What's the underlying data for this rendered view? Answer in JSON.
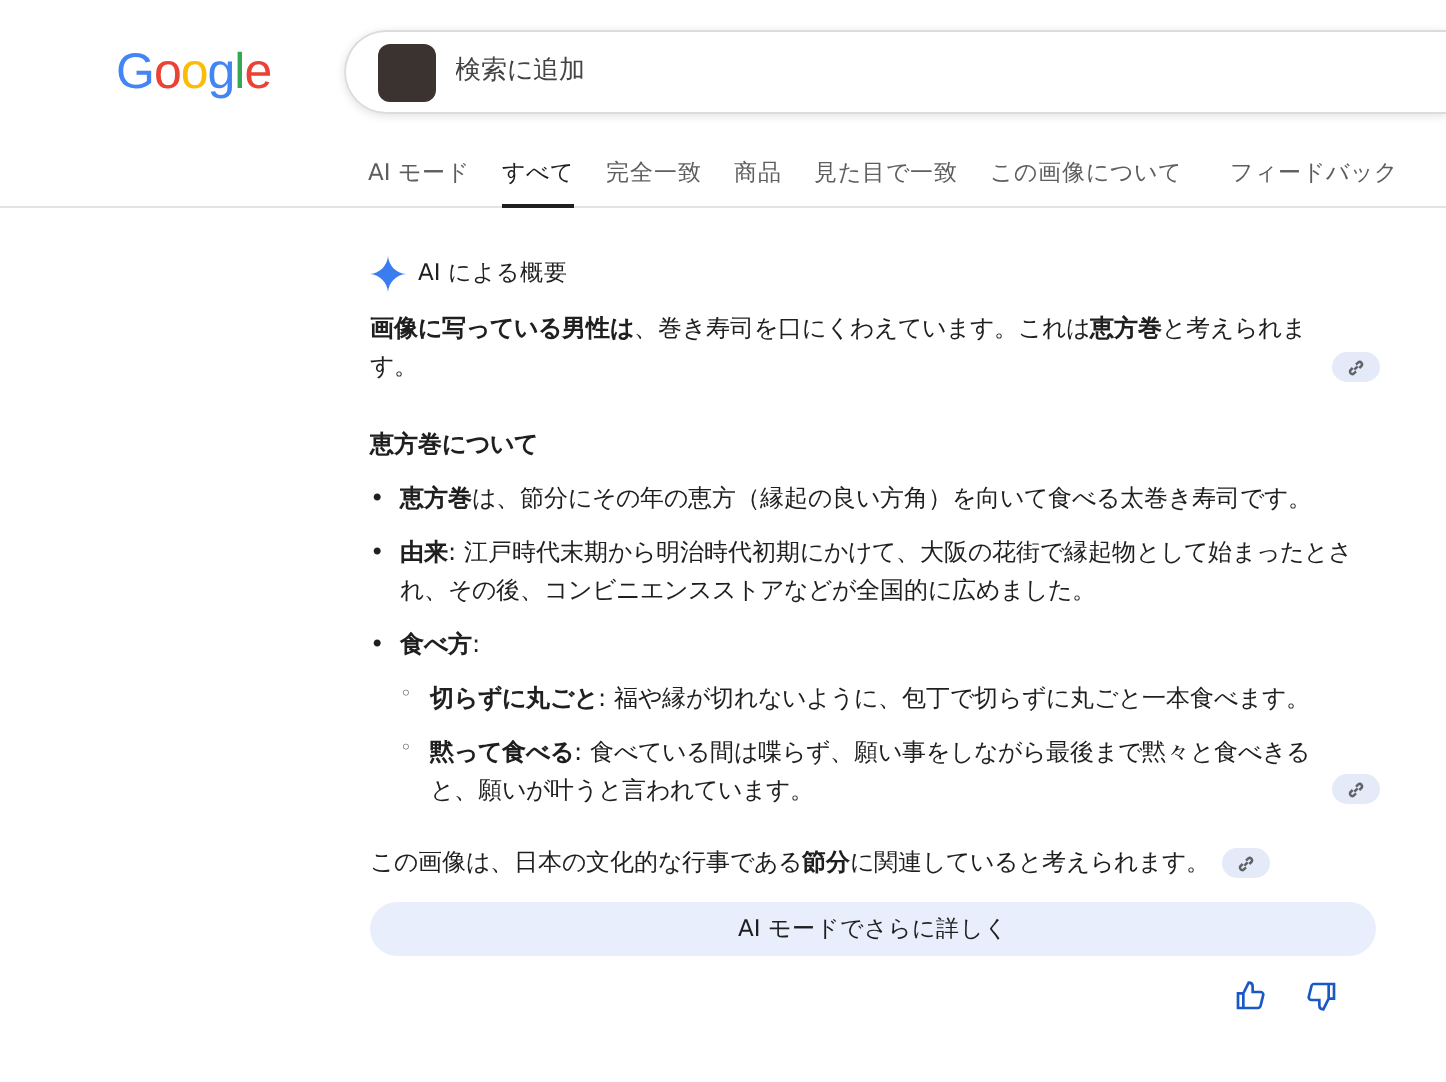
{
  "logo": "Google",
  "search": {
    "placeholder": "検索に追加"
  },
  "tabs": [
    {
      "label": "AI モード",
      "selected": false
    },
    {
      "label": "すべて",
      "selected": true
    },
    {
      "label": "完全一致",
      "selected": false
    },
    {
      "label": "商品",
      "selected": false
    },
    {
      "label": "見た目で一致",
      "selected": false
    },
    {
      "label": "この画像について",
      "selected": false
    },
    {
      "label": "フィードバック",
      "selected": false
    }
  ],
  "overview": {
    "title": "AI による概要",
    "blocks": [
      {
        "kind": "paragraph",
        "text": "**画像に写っている男性は**、巻き寿司を口にくわえています。これは**恵方巻**と考えられます。",
        "link_chip": true
      },
      {
        "kind": "heading",
        "text": "恵方巻について"
      },
      {
        "kind": "bullets",
        "items": [
          {
            "marker": "•",
            "text": "**恵方巻**は、節分にその年の恵方（縁起の良い方角）を向いて食べる太巻き寿司です。"
          },
          {
            "marker": "•",
            "text": "**由来**: 江戸時代末期から明治時代初期にかけて、大阪の花街で縁起物として始まったとされ、その後、コンビニエンスストアなどが全国的に広めました。"
          },
          {
            "marker": "•",
            "text": "**食べ方**:",
            "children": [
              {
                "marker": "◦",
                "text": "**切らずに丸ごと**: 福や縁が切れないように、包丁で切らずに丸ごと一本食べます。"
              },
              {
                "marker": "◦",
                "text": "**黙って食べる**: 食べている間は喋らず、願い事をしながら最後まで黙々と食べきると、願いが叶うと言われています。",
                "link_chip": true
              }
            ]
          }
        ]
      },
      {
        "kind": "paragraph",
        "text": "この画像は、日本の文化的な行事である**節分**に関連していると考えられます。",
        "link_chip": true
      }
    ],
    "more_button": "AI モードでさらに詳しく"
  }
}
